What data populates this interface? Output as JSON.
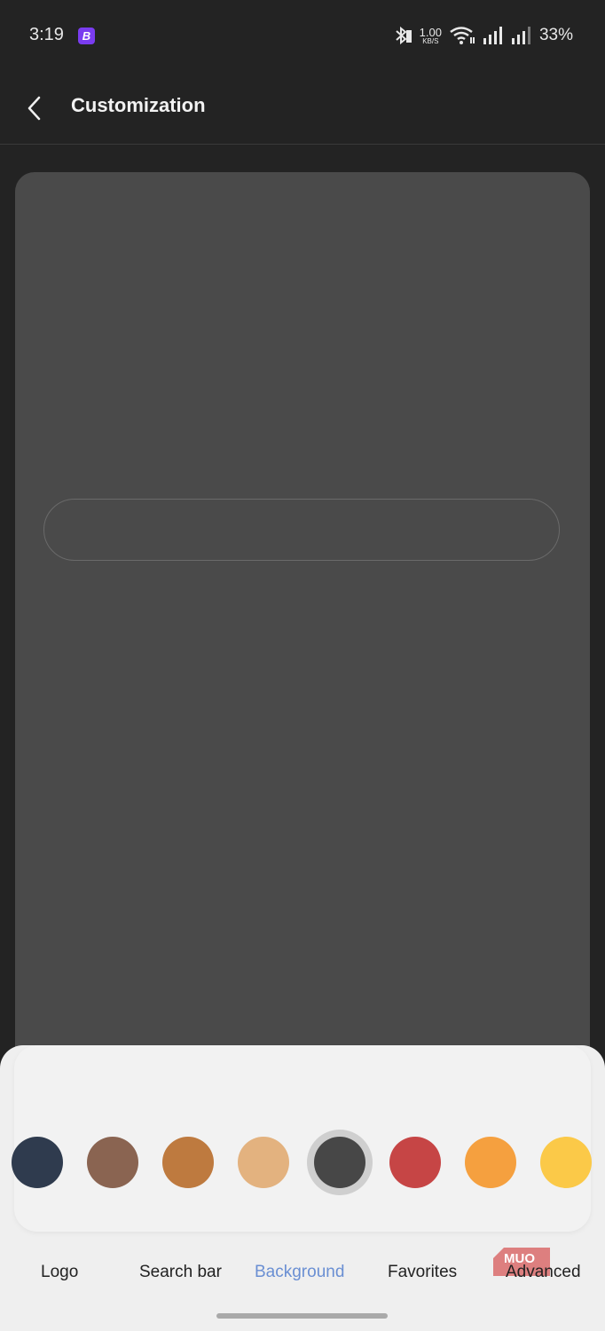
{
  "status_bar": {
    "time": "3:19",
    "app_icon_letter": "B",
    "net_speed_value": "1.00",
    "net_speed_unit": "KB/S",
    "battery": "33%"
  },
  "app_bar": {
    "title": "Customization",
    "back_icon": "chevron-left-icon"
  },
  "palette": {
    "swatches": [
      {
        "color": "#2f3b4e",
        "selected": false
      },
      {
        "color": "#8a6451",
        "selected": false
      },
      {
        "color": "#be7a3f",
        "selected": false
      },
      {
        "color": "#e3b27f",
        "selected": false
      },
      {
        "color": "#474747",
        "selected": true
      },
      {
        "color": "#c64545",
        "selected": false
      },
      {
        "color": "#f5a03f",
        "selected": false
      },
      {
        "color": "#fbc948",
        "selected": false
      }
    ]
  },
  "tabs": [
    {
      "label": "Logo",
      "active": false
    },
    {
      "label": "Search bar",
      "active": false
    },
    {
      "label": "Background",
      "active": true
    },
    {
      "label": "Favorites",
      "active": false
    },
    {
      "label": "Advanced",
      "active": false
    }
  ],
  "watermark": {
    "text": "MUO"
  },
  "colors": {
    "accent": "#6a8fd3",
    "preview_bg": "#4a4a4a",
    "app_bg": "#232323"
  }
}
